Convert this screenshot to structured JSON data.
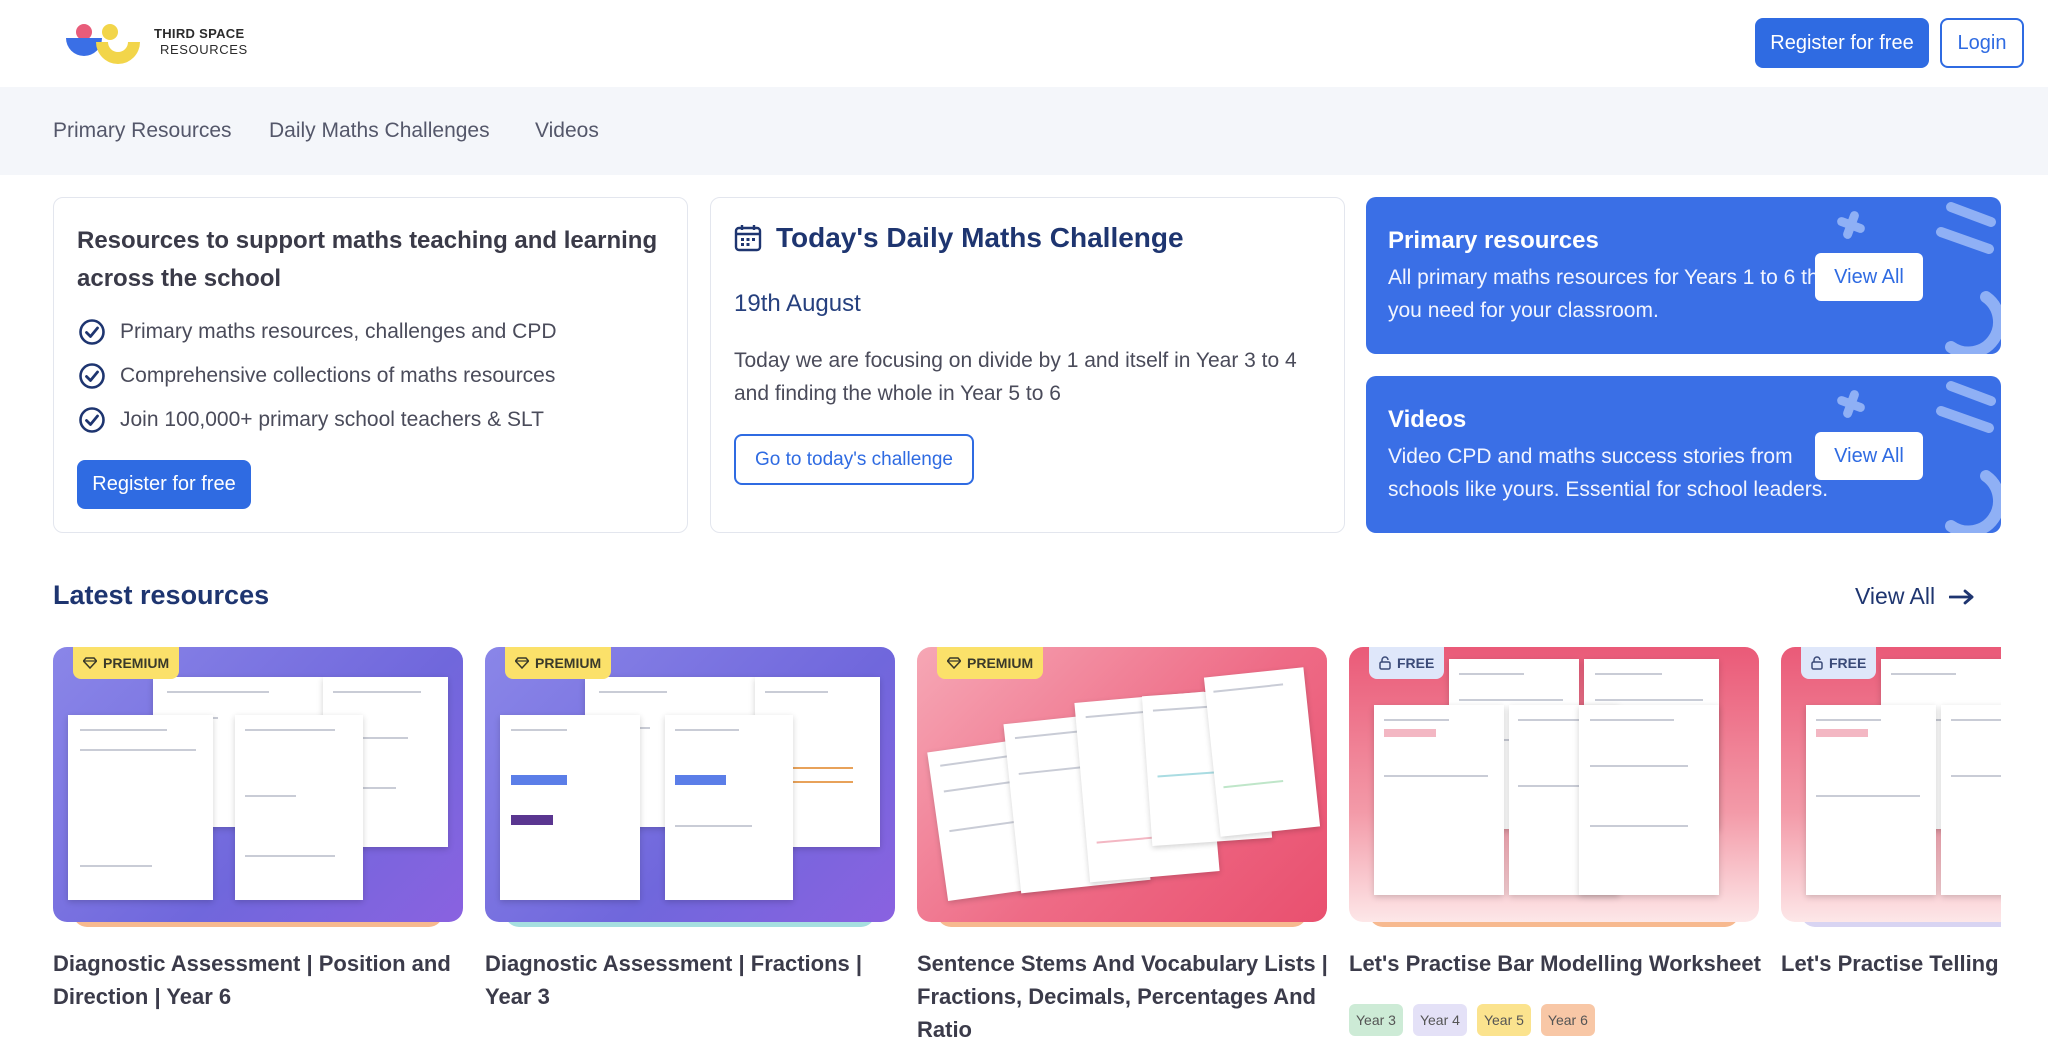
{
  "header": {
    "logo_line1": "THIRD SPACE",
    "logo_line2": "RESOURCES",
    "register_label": "Register for free",
    "login_label": "Login"
  },
  "nav": {
    "items": [
      "Primary Resources",
      "Daily Maths Challenges",
      "Videos"
    ]
  },
  "intro_card": {
    "title": "Resources to support maths teaching and learning across the school",
    "points": [
      "Primary maths resources, challenges and CPD",
      "Comprehensive collections of maths resources",
      "Join 100,000+ primary school teachers & SLT"
    ],
    "button_label": "Register for free"
  },
  "challenge_card": {
    "title": "Today's Daily Maths Challenge",
    "date": "19th August",
    "description": "Today we are focusing on divide by 1 and itself in Year 3 to 4 and finding the whole in Year 5 to 6",
    "button_label": "Go to today's challenge"
  },
  "promos": [
    {
      "title": "Primary resources",
      "description": "All primary maths resources for Years 1 to 6 that you need for your classroom.",
      "button_label": "View All"
    },
    {
      "title": "Videos",
      "description": "Video CPD and maths success stories from schools like yours. Essential for school leaders.",
      "button_label": "View All"
    }
  ],
  "latest": {
    "title": "Latest resources",
    "view_all_label": "View All",
    "items": [
      {
        "badge": "PREMIUM",
        "title": "Diagnostic Assessment | Position and Direction | Year 6",
        "tags": []
      },
      {
        "badge": "PREMIUM",
        "title": "Diagnostic Assessment | Fractions | Year 3",
        "tags": []
      },
      {
        "badge": "PREMIUM",
        "title": "Sentence Stems And Vocabulary Lists | Fractions, Decimals, Percentages And Ratio",
        "tags": []
      },
      {
        "badge": "FREE",
        "title": "Let's Practise Bar Modelling Worksheet",
        "tags": [
          "Year 3",
          "Year 4",
          "Year 5",
          "Year 6"
        ]
      },
      {
        "badge": "FREE",
        "title": "Let's Practise Telling Time Sheets",
        "tags": []
      }
    ]
  },
  "colors": {
    "primary": "#2f6be2",
    "navy": "#1e3570",
    "promo_bg": "#3a6fe6",
    "premium_badge": "#fbe16a",
    "free_badge": "#dfe7fa"
  }
}
